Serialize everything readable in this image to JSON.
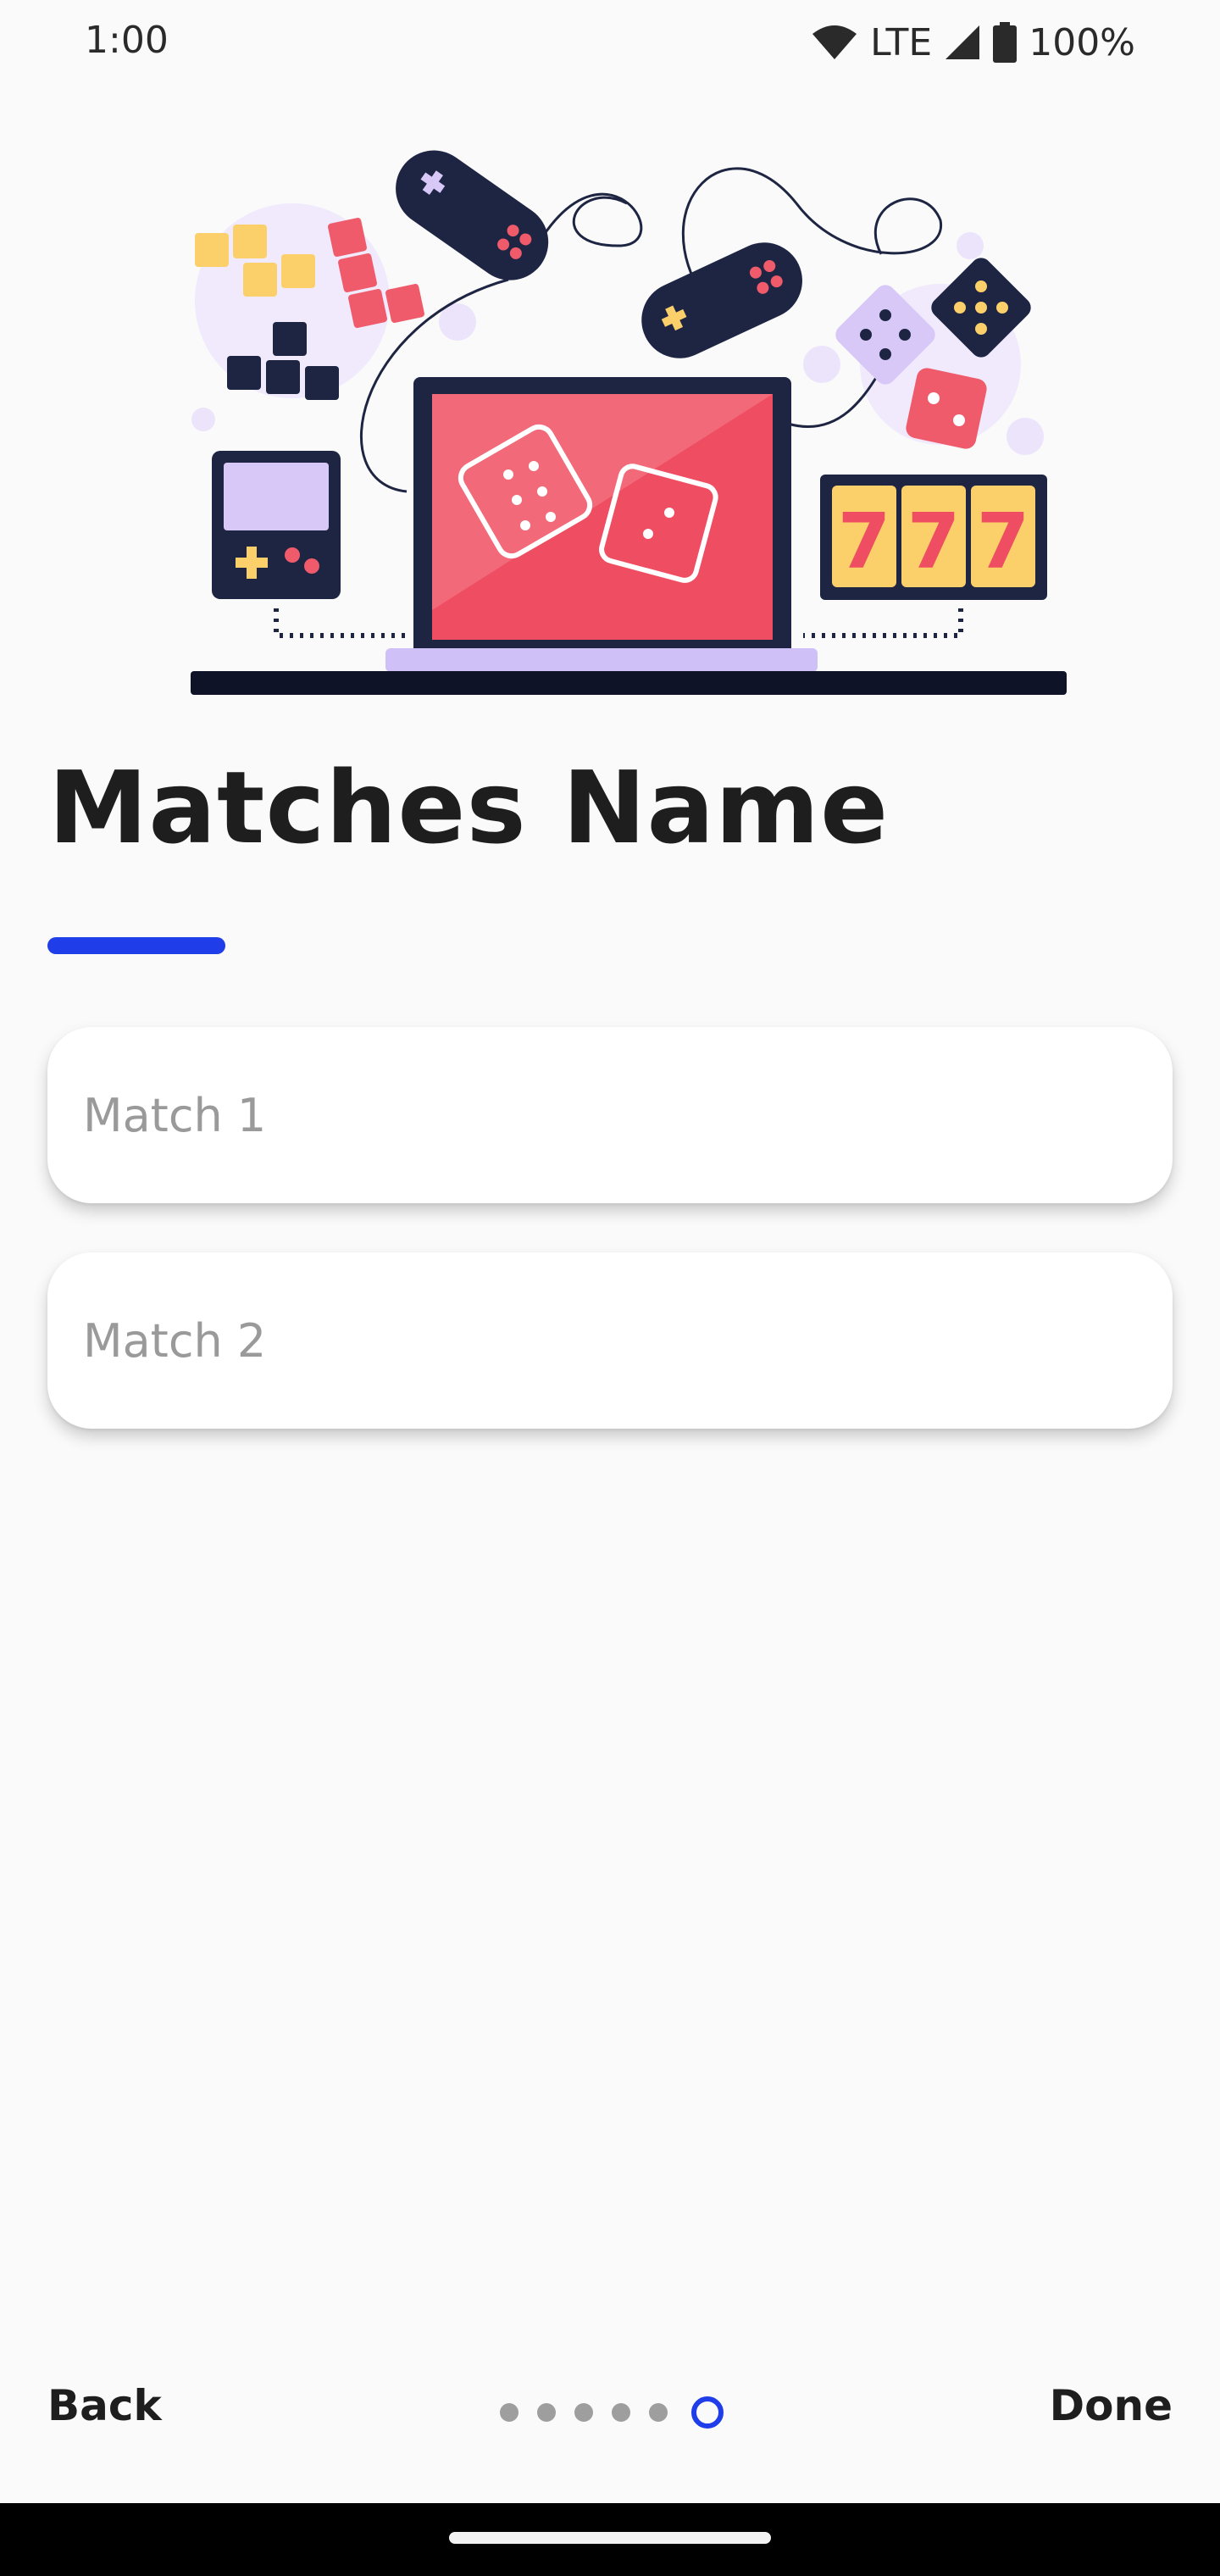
{
  "status_bar": {
    "time": "1:00",
    "network": "LTE",
    "battery": "100%",
    "icons": [
      "wifi-icon",
      "cell-signal-icon",
      "battery-icon"
    ]
  },
  "illustration": {
    "description_icon": "gaming-illustration",
    "slot_digits": [
      "7",
      "7",
      "7"
    ]
  },
  "page": {
    "title": "Matches Name",
    "accent_color": "#1f3de8"
  },
  "fields": [
    {
      "placeholder": "Match 1",
      "value": ""
    },
    {
      "placeholder": "Match 2",
      "value": ""
    }
  ],
  "nav": {
    "back_label": "Back",
    "done_label": "Done",
    "total_pages": 6,
    "current_page": 6
  }
}
